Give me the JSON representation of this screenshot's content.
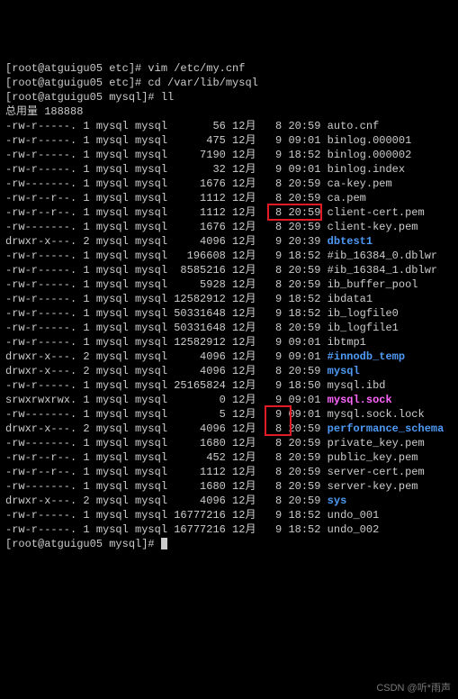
{
  "header": {
    "p1": "[root@atguigu05 etc]# vim /etc/my.cnf",
    "p2": "[root@atguigu05 etc]# cd /var/lib/mysql",
    "p3": "[root@atguigu05 mysql]# ll",
    "total": "总用量 188888"
  },
  "rows": [
    {
      "perm": "-rw-r-----.",
      "ln": "1",
      "u": "mysql",
      "g": "mysql",
      "size": "56",
      "mon": "12月",
      "day": "8",
      "time": "20:59",
      "name": "auto.cnf",
      "cls": ""
    },
    {
      "perm": "-rw-r-----.",
      "ln": "1",
      "u": "mysql",
      "g": "mysql",
      "size": "475",
      "mon": "12月",
      "day": "9",
      "time": "09:01",
      "name": "binlog.000001",
      "cls": ""
    },
    {
      "perm": "-rw-r-----.",
      "ln": "1",
      "u": "mysql",
      "g": "mysql",
      "size": "7190",
      "mon": "12月",
      "day": "9",
      "time": "18:52",
      "name": "binlog.000002",
      "cls": ""
    },
    {
      "perm": "-rw-r-----.",
      "ln": "1",
      "u": "mysql",
      "g": "mysql",
      "size": "32",
      "mon": "12月",
      "day": "9",
      "time": "09:01",
      "name": "binlog.index",
      "cls": ""
    },
    {
      "perm": "-rw-------.",
      "ln": "1",
      "u": "mysql",
      "g": "mysql",
      "size": "1676",
      "mon": "12月",
      "day": "8",
      "time": "20:59",
      "name": "ca-key.pem",
      "cls": ""
    },
    {
      "perm": "-rw-r--r--.",
      "ln": "1",
      "u": "mysql",
      "g": "mysql",
      "size": "1112",
      "mon": "12月",
      "day": "8",
      "time": "20:59",
      "name": "ca.pem",
      "cls": ""
    },
    {
      "perm": "-rw-r--r--.",
      "ln": "1",
      "u": "mysql",
      "g": "mysql",
      "size": "1112",
      "mon": "12月",
      "day": "8",
      "time": "20:59",
      "name": "client-cert.pem",
      "cls": ""
    },
    {
      "perm": "-rw-------.",
      "ln": "1",
      "u": "mysql",
      "g": "mysql",
      "size": "1676",
      "mon": "12月",
      "day": "8",
      "time": "20:59",
      "name": "client-key.pem",
      "cls": ""
    },
    {
      "perm": "drwxr-x---.",
      "ln": "2",
      "u": "mysql",
      "g": "mysql",
      "size": "4096",
      "mon": "12月",
      "day": "9",
      "time": "20:39",
      "name": "dbtest1",
      "cls": "dir"
    },
    {
      "perm": "-rw-r-----.",
      "ln": "1",
      "u": "mysql",
      "g": "mysql",
      "size": "196608",
      "mon": "12月",
      "day": "9",
      "time": "18:52",
      "name": "#ib_16384_0.dblwr",
      "cls": ""
    },
    {
      "perm": "-rw-r-----.",
      "ln": "1",
      "u": "mysql",
      "g": "mysql",
      "size": "8585216",
      "mon": "12月",
      "day": "8",
      "time": "20:59",
      "name": "#ib_16384_1.dblwr",
      "cls": ""
    },
    {
      "perm": "-rw-r-----.",
      "ln": "1",
      "u": "mysql",
      "g": "mysql",
      "size": "5928",
      "mon": "12月",
      "day": "8",
      "time": "20:59",
      "name": "ib_buffer_pool",
      "cls": ""
    },
    {
      "perm": "-rw-r-----.",
      "ln": "1",
      "u": "mysql",
      "g": "mysql",
      "size": "12582912",
      "mon": "12月",
      "day": "9",
      "time": "18:52",
      "name": "ibdata1",
      "cls": ""
    },
    {
      "perm": "-rw-r-----.",
      "ln": "1",
      "u": "mysql",
      "g": "mysql",
      "size": "50331648",
      "mon": "12月",
      "day": "9",
      "time": "18:52",
      "name": "ib_logfile0",
      "cls": ""
    },
    {
      "perm": "-rw-r-----.",
      "ln": "1",
      "u": "mysql",
      "g": "mysql",
      "size": "50331648",
      "mon": "12月",
      "day": "8",
      "time": "20:59",
      "name": "ib_logfile1",
      "cls": ""
    },
    {
      "perm": "-rw-r-----.",
      "ln": "1",
      "u": "mysql",
      "g": "mysql",
      "size": "12582912",
      "mon": "12月",
      "day": "9",
      "time": "09:01",
      "name": "ibtmp1",
      "cls": ""
    },
    {
      "perm": "drwxr-x---.",
      "ln": "2",
      "u": "mysql",
      "g": "mysql",
      "size": "4096",
      "mon": "12月",
      "day": "9",
      "time": "09:01",
      "name": "#innodb_temp",
      "cls": "dir"
    },
    {
      "perm": "drwxr-x---.",
      "ln": "2",
      "u": "mysql",
      "g": "mysql",
      "size": "4096",
      "mon": "12月",
      "day": "8",
      "time": "20:59",
      "name": "mysql",
      "cls": "dir"
    },
    {
      "perm": "-rw-r-----.",
      "ln": "1",
      "u": "mysql",
      "g": "mysql",
      "size": "25165824",
      "mon": "12月",
      "day": "9",
      "time": "18:50",
      "name": "mysql.ibd",
      "cls": ""
    },
    {
      "perm": "srwxrwxrwx.",
      "ln": "1",
      "u": "mysql",
      "g": "mysql",
      "size": "0",
      "mon": "12月",
      "day": "9",
      "time": "09:01",
      "name": "mysql.sock",
      "cls": "socket"
    },
    {
      "perm": "-rw-------.",
      "ln": "1",
      "u": "mysql",
      "g": "mysql",
      "size": "5",
      "mon": "12月",
      "day": "9",
      "time": "09:01",
      "name": "mysql.sock.lock",
      "cls": ""
    },
    {
      "perm": "drwxr-x---.",
      "ln": "2",
      "u": "mysql",
      "g": "mysql",
      "size": "4096",
      "mon": "12月",
      "day": "8",
      "time": "20:59",
      "name": "performance_schema",
      "cls": "dir"
    },
    {
      "perm": "-rw-------.",
      "ln": "1",
      "u": "mysql",
      "g": "mysql",
      "size": "1680",
      "mon": "12月",
      "day": "8",
      "time": "20:59",
      "name": "private_key.pem",
      "cls": ""
    },
    {
      "perm": "-rw-r--r--.",
      "ln": "1",
      "u": "mysql",
      "g": "mysql",
      "size": "452",
      "mon": "12月",
      "day": "8",
      "time": "20:59",
      "name": "public_key.pem",
      "cls": ""
    },
    {
      "perm": "-rw-r--r--.",
      "ln": "1",
      "u": "mysql",
      "g": "mysql",
      "size": "1112",
      "mon": "12月",
      "day": "8",
      "time": "20:59",
      "name": "server-cert.pem",
      "cls": ""
    },
    {
      "perm": "-rw-------.",
      "ln": "1",
      "u": "mysql",
      "g": "mysql",
      "size": "1680",
      "mon": "12月",
      "day": "8",
      "time": "20:59",
      "name": "server-key.pem",
      "cls": ""
    },
    {
      "perm": "drwxr-x---.",
      "ln": "2",
      "u": "mysql",
      "g": "mysql",
      "size": "4096",
      "mon": "12月",
      "day": "8",
      "time": "20:59",
      "name": "sys",
      "cls": "dir"
    },
    {
      "perm": "-rw-r-----.",
      "ln": "1",
      "u": "mysql",
      "g": "mysql",
      "size": "16777216",
      "mon": "12月",
      "day": "9",
      "time": "18:52",
      "name": "undo_001",
      "cls": ""
    },
    {
      "perm": "-rw-r-----.",
      "ln": "1",
      "u": "mysql",
      "g": "mysql",
      "size": "16777216",
      "mon": "12月",
      "day": "9",
      "time": "18:52",
      "name": "undo_002",
      "cls": ""
    }
  ],
  "footer": {
    "prompt": "[root@atguigu05 mysql]# "
  },
  "watermark": "CSDN @听*雨声"
}
